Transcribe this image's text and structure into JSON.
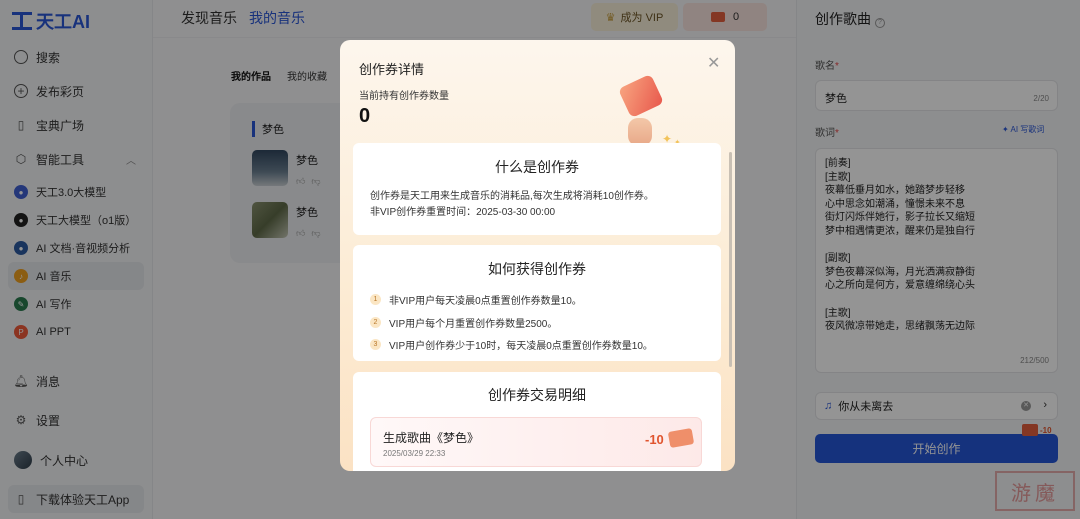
{
  "app": {
    "name": "天工AI"
  },
  "sidebar": {
    "items": [
      {
        "label": "搜索",
        "icon": "search-icon"
      },
      {
        "label": "发布彩页",
        "icon": "plus-circle-icon"
      },
      {
        "label": "宝典广场",
        "icon": "book-icon"
      },
      {
        "label": "智能工具",
        "icon": "cube-icon"
      }
    ],
    "tools": [
      {
        "label": "天工3.0大模型",
        "color": "#3f5fd1"
      },
      {
        "label": "天工大模型（o1版）",
        "color": "#222222"
      },
      {
        "label": "AI 文档·音视频分析",
        "color": "#2c5aa0"
      },
      {
        "label": "AI 音乐",
        "color": "#f0a020"
      },
      {
        "label": "AI 写作",
        "color": "#2a7b4f"
      },
      {
        "label": "AI PPT",
        "color": "#ef5a3a"
      }
    ],
    "bottom": [
      {
        "label": "消息",
        "icon": "bell-icon"
      },
      {
        "label": "设置",
        "icon": "gear-icon"
      },
      {
        "label": "个人中心",
        "icon": "avatar"
      },
      {
        "label": "下载体验天工App",
        "icon": "phone-icon"
      }
    ]
  },
  "topbar": {
    "tabs": [
      "发现音乐",
      "我的音乐"
    ],
    "vip_label": "成为 VIP",
    "tickets": "0"
  },
  "music": {
    "subtabs": [
      "我的作品",
      "我的收藏"
    ],
    "card_title": "梦色",
    "songs": [
      {
        "name": "梦色",
        "tag": "V"
      },
      {
        "name": "梦色",
        "tag": "V"
      }
    ]
  },
  "create": {
    "title": "创作歌曲",
    "name_label": "歌名",
    "name_value": "梦色",
    "name_count": "2/20",
    "lyrics_label": "歌词",
    "ai_write": "AI 写歌词",
    "lyrics": "[前奏]\n[主歌]\n夜幕低垂月如水，她踏梦步轻移\n心中思念如潮涌，憧憬未来不息\n街灯闪烁伴她行，影子拉长又缩短\n梦中相遇情更浓，醒来仍是独自行\n\n[副歌]\n梦色夜幕深似海，月光洒满寂静街\n心之所向是何方，爱意缠绵绕心头\n\n[主歌]\n夜风微凉带她走，思绪飘荡无边际",
    "lyrics_count": "212/500",
    "style": "你从未离去",
    "start": "开始创作",
    "cost": "-10"
  },
  "watermark": "游魔",
  "modal": {
    "title": "创作券详情",
    "holding_label": "当前持有创作券数量",
    "holding_count": "0",
    "what_title": "什么是创作券",
    "what_line1": "创作券是天工用来生成音乐的消耗品,每次生成将消耗10创作券。",
    "what_line2": "非VIP创作券重置时间：2025-03-30 00:00",
    "how_title": "如何获得创作券",
    "how_items": [
      "非VIP用户每天凌晨0点重置创作券数量10。",
      "VIP用户每个月重置创作券数量2500。",
      "VIP用户创作券少于10时，每天凌晨0点重置创作券数量10。"
    ],
    "tx_title": "创作券交易明细",
    "tx": {
      "name": "生成歌曲《梦色》",
      "date": "2025/03/29 22:33",
      "amount": "-10"
    }
  }
}
